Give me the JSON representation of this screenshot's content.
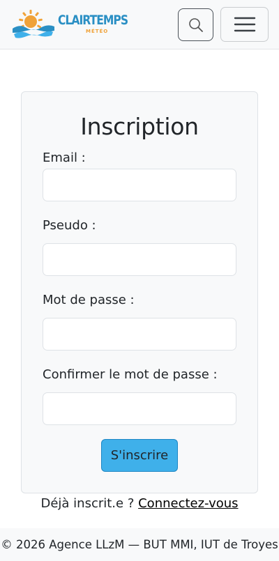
{
  "header": {
    "logo_name": "CLAIRTEMPS",
    "logo_tagline": "MÉTÉO",
    "search_icon": "search-icon",
    "menu_icon": "hamburger-menu-icon"
  },
  "form": {
    "title": "Inscription",
    "email_label": "Email :",
    "email_value": "",
    "pseudo_label": "Pseudo :",
    "pseudo_value": "",
    "password_label": "Mot de passe :",
    "password_value": "",
    "confirm_label": "Confirmer le mot de passe :",
    "confirm_value": "",
    "submit_label": "S'inscrire"
  },
  "login_prompt": {
    "text": "Déjà inscrit.e ?",
    "link_label": "Connectez-vous"
  },
  "footer": {
    "text": "© 2026 Agence LLzM — BUT MMI, IUT de Troyes"
  },
  "colors": {
    "accent": "#3fb0ea",
    "logo_blue": "#2a8fc4",
    "logo_orange": "#f0a238"
  }
}
